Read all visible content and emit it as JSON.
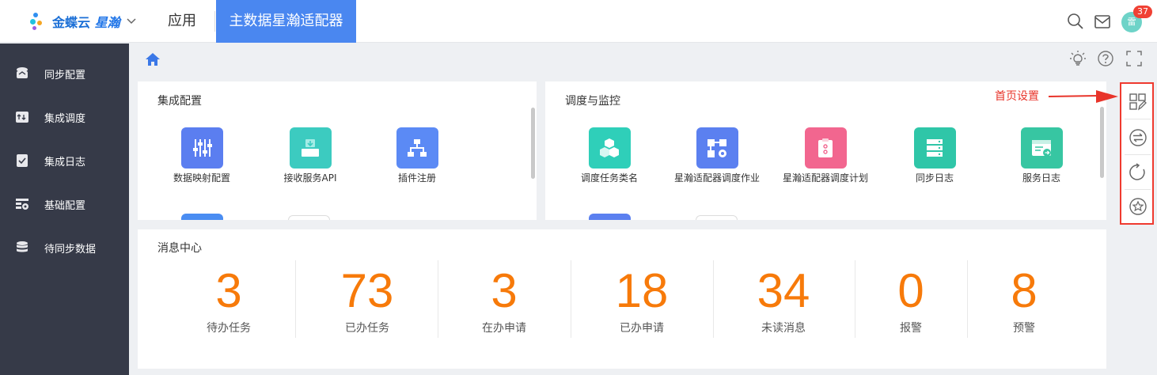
{
  "header": {
    "logo_brand": "金蝶云",
    "logo_product": "星瀚",
    "nav_app": "应用",
    "nav_active": "主数据星瀚适配器",
    "avatar_text": "雷",
    "notification_count": "37"
  },
  "sidebar": {
    "items": [
      {
        "label": "同步配置",
        "icon": "sync-config-icon"
      },
      {
        "label": "集成调度",
        "icon": "integration-schedule-icon"
      },
      {
        "label": "集成日志",
        "icon": "integration-log-icon"
      },
      {
        "label": "基础配置",
        "icon": "basic-config-icon"
      },
      {
        "label": "待同步数据",
        "icon": "database-icon"
      }
    ]
  },
  "integration": {
    "title": "集成配置",
    "apps": [
      {
        "label": "数据映射配置",
        "icon": "sliders-icon",
        "color": "#5b7ef0"
      },
      {
        "label": "接收服务API",
        "icon": "inbox-icon",
        "color": "#3ccbc0"
      },
      {
        "label": "插件注册",
        "icon": "org-chart-icon",
        "color": "#5b8af5"
      }
    ]
  },
  "monitor": {
    "title": "调度与监控",
    "apps": [
      {
        "label": "调度任务类名",
        "icon": "cubes-icon",
        "color": "#2fcfb9"
      },
      {
        "label": "星瀚适配器调度作业",
        "icon": "workflow-icon",
        "color": "#5b80f0"
      },
      {
        "label": "星瀚适配器调度计划",
        "icon": "clipboard-icon",
        "color": "#f2668f"
      },
      {
        "label": "同步日志",
        "icon": "server-icon",
        "color": "#2fc6a8"
      },
      {
        "label": "服务日志",
        "icon": "service-log-icon",
        "color": "#37c6a2"
      }
    ]
  },
  "messages": {
    "title": "消息中心",
    "stats": [
      {
        "value": "3",
        "label": "待办任务"
      },
      {
        "value": "73",
        "label": "已办任务"
      },
      {
        "value": "3",
        "label": "在办申请"
      },
      {
        "value": "18",
        "label": "已办申请"
      },
      {
        "value": "34",
        "label": "未读消息"
      },
      {
        "value": "0",
        "label": "报警"
      },
      {
        "value": "8",
        "label": "预警"
      }
    ]
  },
  "float_toolbar": {
    "hint": "首页设置"
  },
  "colors": {
    "accent": "#4a87f0",
    "sidebar_bg": "#363a48",
    "stat_number": "#f77a0a",
    "highlight_border": "#ef3a2f"
  }
}
